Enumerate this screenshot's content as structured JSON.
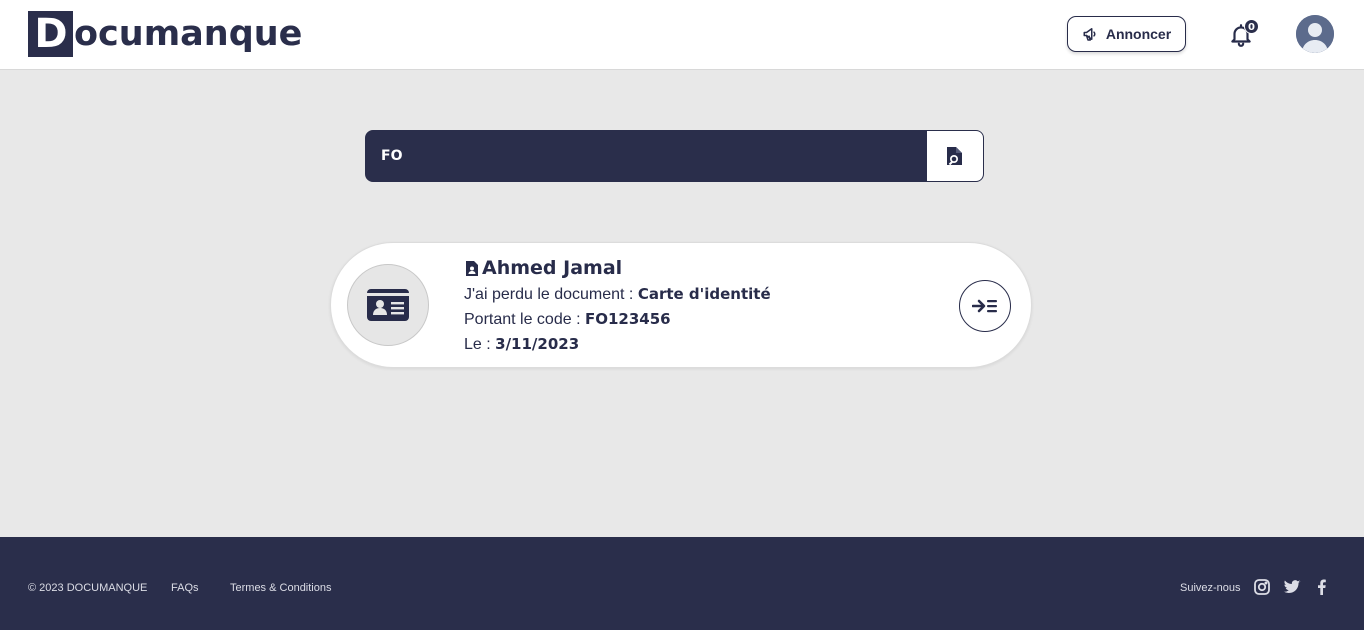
{
  "header": {
    "logo_letter": "D",
    "logo_rest": "ocumanque",
    "announce_label": "Annoncer",
    "notification_count": "0"
  },
  "search": {
    "value": "FO",
    "icon": "search-document-icon"
  },
  "result": {
    "name": "Ahmed Jamal",
    "lost_prefix": "J'ai perdu le document :",
    "document_type": "Carte d'identité",
    "code_prefix": "Portant le code :",
    "code": "FO123456",
    "date_prefix": "Le :",
    "date": "3/11/2023",
    "icon": "id-card-icon"
  },
  "footer": {
    "copyright": "© 2023 DOCUMANQUE",
    "faqs": "FAQs",
    "terms": "Termes & Conditions",
    "follow": "Suivez-nous",
    "socials": [
      "instagram-icon",
      "twitter-icon",
      "facebook-icon"
    ]
  },
  "colors": {
    "primary": "#2a2e4b",
    "background": "#e8e8e8",
    "surface": "#ffffff"
  }
}
